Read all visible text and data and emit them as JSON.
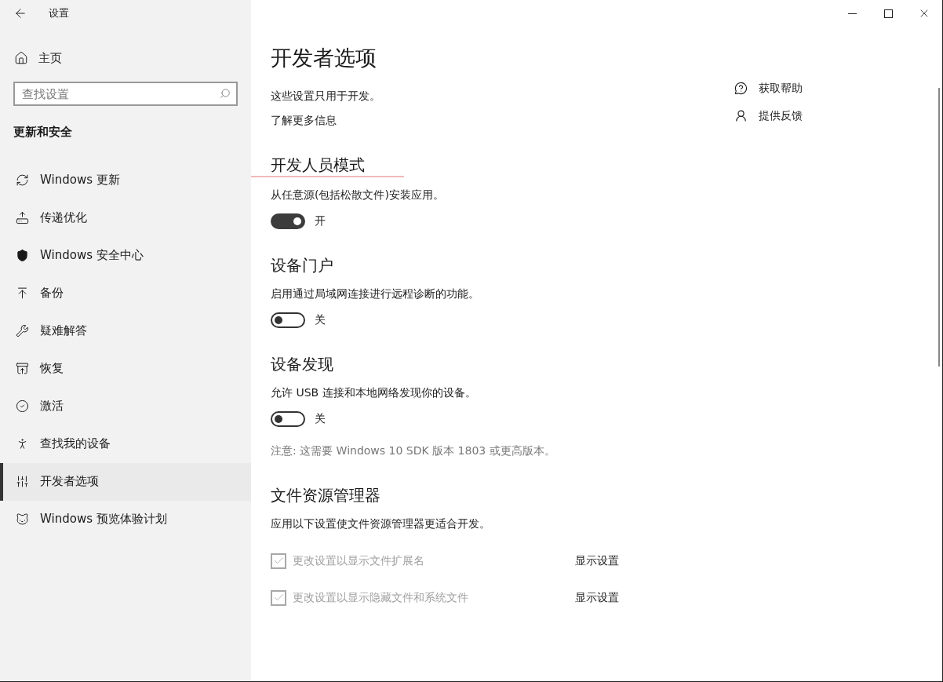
{
  "window": {
    "title": "设置"
  },
  "sidebar": {
    "home": "主页",
    "search": {
      "placeholder": "查找设置"
    },
    "section": "更新和安全",
    "items": [
      {
        "label": "Windows 更新",
        "selected": false
      },
      {
        "label": "传递优化",
        "selected": false
      },
      {
        "label": "Windows 安全中心",
        "selected": false
      },
      {
        "label": "备份",
        "selected": false
      },
      {
        "label": "疑难解答",
        "selected": false
      },
      {
        "label": "恢复",
        "selected": false
      },
      {
        "label": "激活",
        "selected": false
      },
      {
        "label": "查找我的设备",
        "selected": false
      },
      {
        "label": "开发者选项",
        "selected": true
      },
      {
        "label": "Windows 预览体验计划",
        "selected": false
      }
    ]
  },
  "page": {
    "title": "开发者选项",
    "description": "这些设置只用于开发。",
    "learn_more": "了解更多信息",
    "sections": [
      {
        "heading": "开发人员模式",
        "description": "从任意源(包括松散文件)安装应用。",
        "toggle": {
          "on": true,
          "label": "开"
        }
      },
      {
        "heading": "设备门户",
        "description": "启用通过局域网连接进行远程诊断的功能。",
        "toggle": {
          "on": false,
          "label": "关"
        }
      },
      {
        "heading": "设备发现",
        "description": "允许 USB 连接和本地网络发现你的设备。",
        "toggle": {
          "on": false,
          "label": "关"
        },
        "note": "注意: 这需要 Windows 10 SDK 版本 1803 或更高版本。"
      },
      {
        "heading": "文件资源管理器",
        "description": "应用以下设置使文件资源管理器更适合开发。",
        "checkboxes": [
          {
            "label": "更改设置以显示文件扩展名",
            "checked": true,
            "disabled": true,
            "action": "显示设置"
          },
          {
            "label": "更改设置以显示隐藏文件和系统文件",
            "checked": true,
            "disabled": true,
            "action": "显示设置"
          }
        ]
      }
    ]
  },
  "help_links": [
    "获取帮助",
    "提供反馈"
  ]
}
